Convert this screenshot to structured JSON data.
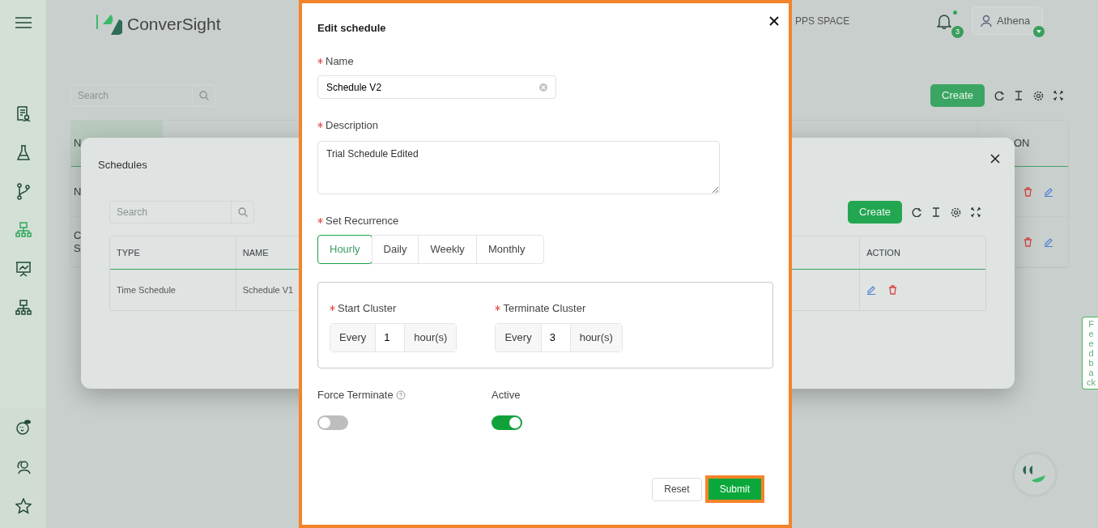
{
  "sidebar": {
    "items": [
      {
        "kind": "report",
        "selected": false
      },
      {
        "kind": "flask",
        "selected": false
      },
      {
        "kind": "branch",
        "selected": false
      },
      {
        "kind": "hierarchy",
        "selected": true
      },
      {
        "kind": "presentation",
        "selected": false
      },
      {
        "kind": "hierarchy",
        "selected": false
      }
    ],
    "bottom_items": [
      {
        "kind": "bot"
      },
      {
        "kind": "users"
      },
      {
        "kind": "star"
      }
    ]
  },
  "header": {
    "logo_text": "ConverSight",
    "workspace": "PPS SPACE",
    "notifications": {
      "count": "3",
      "unread": true
    },
    "user": {
      "name": "Athena"
    }
  },
  "page": {
    "search": {
      "placeholder": "Search"
    },
    "create_button": "Create",
    "table": {
      "first_column_header": "N",
      "last_column_header": "ON",
      "rows": [
        {
          "lines": [
            "N"
          ]
        },
        {
          "lines": [
            "C",
            "S"
          ]
        }
      ]
    }
  },
  "schedules_dialog": {
    "title": "Schedules",
    "search": {
      "placeholder": "Search"
    },
    "create_button": "Create",
    "table": {
      "columns": [
        "TYPE",
        "NAME",
        "ACTION"
      ],
      "rows": [
        {
          "type": "Time Schedule",
          "name": "Schedule V1"
        }
      ]
    }
  },
  "edit_dialog": {
    "title": "Edit schedule",
    "name": {
      "label": "Name",
      "required": true,
      "value": "Schedule V2"
    },
    "description": {
      "label": "Description",
      "required": true,
      "value": "Trial Schedule Edited"
    },
    "recurrence": {
      "label": "Set Recurrence",
      "required": true,
      "options": [
        {
          "label": "Hourly",
          "selected": true
        },
        {
          "label": "Daily",
          "selected": false
        },
        {
          "label": "Weekly",
          "selected": false
        },
        {
          "label": "Monthly",
          "selected": false
        }
      ]
    },
    "clusters": [
      {
        "label": "Start Cluster",
        "required": true,
        "prefix": "Every",
        "value": "1",
        "suffix": "hour(s)"
      },
      {
        "label": "Terminate Cluster",
        "required": true,
        "prefix": "Every",
        "value": "3",
        "suffix": "hour(s)"
      }
    ],
    "toggles": [
      {
        "label": "Force Terminate",
        "help": true,
        "on": false
      },
      {
        "label": "Active",
        "on": true
      }
    ],
    "buttons": {
      "reset": "Reset",
      "submit": "Submit"
    }
  },
  "feedback_tab": "Feedback"
}
